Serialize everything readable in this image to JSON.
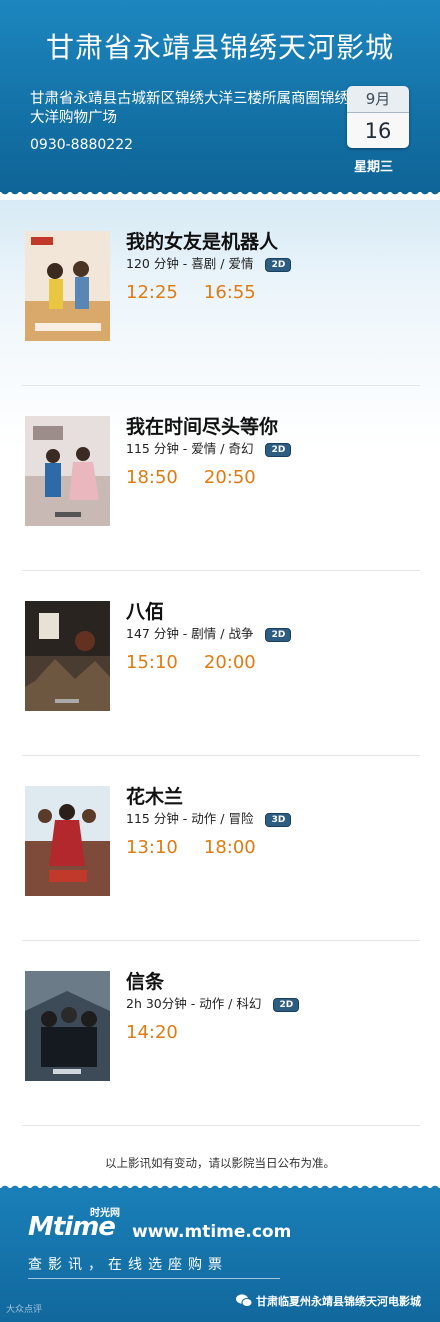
{
  "cinema": {
    "name": "甘肃省永靖县锦绣天河影城",
    "address": "甘肃省永靖县古城新区锦绣大洋三楼所属商圈锦绣大洋购物广场",
    "phone": "0930-8880222"
  },
  "date": {
    "month": "9月",
    "day": "16",
    "weekday": "星期三"
  },
  "movies": [
    {
      "title": "我的女友是机器人",
      "meta": "120 分钟 - 喜剧 / 爱情",
      "format": "2D",
      "times": [
        "12:25",
        "16:55"
      ],
      "poster_icon": "poster-my-robot-girlfriend"
    },
    {
      "title": "我在时间尽头等你",
      "meta": "115 分钟 - 爱情 / 奇幻",
      "format": "2D",
      "times": [
        "18:50",
        "20:50"
      ],
      "poster_icon": "poster-love-you-forever"
    },
    {
      "title": "八佰",
      "meta": "147 分钟 - 剧情 / 战争",
      "format": "2D",
      "times": [
        "15:10",
        "20:00"
      ],
      "poster_icon": "poster-the-eight-hundred"
    },
    {
      "title": "花木兰",
      "meta": "115 分钟 - 动作 / 冒险",
      "format": "3D",
      "times": [
        "13:10",
        "18:00"
      ],
      "poster_icon": "poster-mulan"
    },
    {
      "title": "信条",
      "meta": "2h 30分钟 - 动作 / 科幻",
      "format": "2D",
      "times": [
        "14:20"
      ],
      "poster_icon": "poster-tenet"
    }
  ],
  "notice": "以上影讯如有变动，请以影院当日公布为准。",
  "footer": {
    "logo": "Mtime",
    "logo_cn": "时光网",
    "url": "www.mtime.com",
    "slogan": "查影讯，在线选座购票",
    "wechat": "甘肃临夏州永靖县锦绣天河电影城",
    "watermark": "大众点评"
  },
  "colors": {
    "header": "#1473a8",
    "time": "#e07b12",
    "badge": "#2e5d82"
  }
}
